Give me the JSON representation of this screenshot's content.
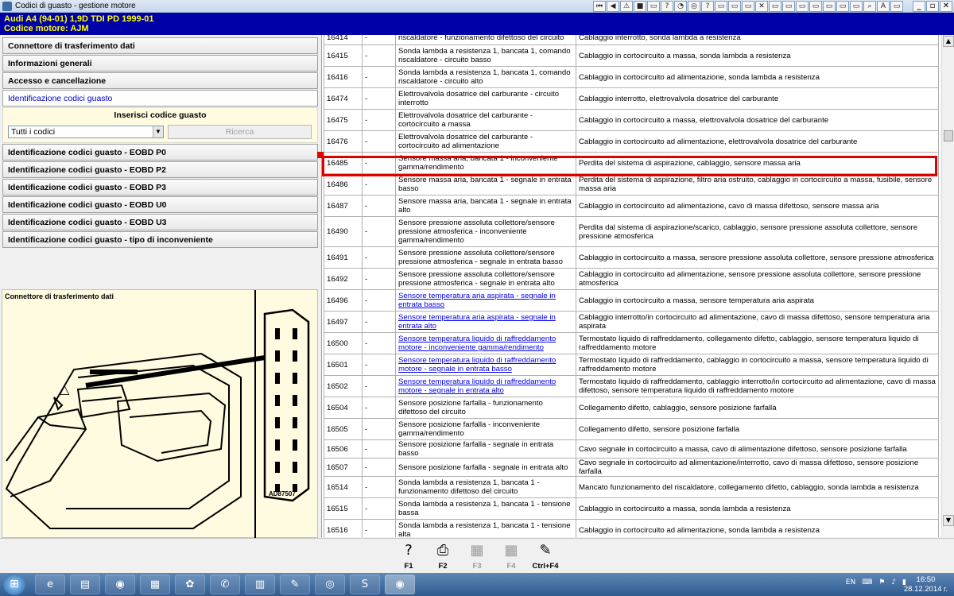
{
  "window": {
    "title": "Codici di guasto - gestione motore"
  },
  "vehicle": {
    "line1": "Audi   A4 (94-01) 1,9D TDI PD 1999-01",
    "line2": "Codice motore: AJM"
  },
  "toolbar_icons": [
    "⏮",
    "◀",
    "⚠",
    "■",
    "▭",
    "?",
    "◔",
    "◎",
    "?",
    "▭",
    "▭",
    "▭",
    "✕",
    "▭",
    "▭",
    "▭",
    "▭",
    "▭",
    "▭",
    "▭",
    "⌕",
    "A",
    "▭"
  ],
  "window_controls": {
    "minimize": "_",
    "restore": "▫",
    "close": "✕"
  },
  "nav": {
    "top_items": [
      "Connettore di trasferimento dati",
      "Informazioni generali",
      "Accesso e cancellazione",
      "Identificazione codici guasto"
    ],
    "search": {
      "label": "Inserisci codice guasto",
      "select_value": "Tutti i codici",
      "button": "Ricerca"
    },
    "bottom_items": [
      "Identificazione codici guasto - EOBD P0",
      "Identificazione codici guasto - EOBD P2",
      "Identificazione codici guasto - EOBD P3",
      "Identificazione codici guasto - EOBD U0",
      "Identificazione codici guasto - EOBD U3",
      "Identificazione codici guasto - tipo di inconveniente"
    ]
  },
  "connector": {
    "caption": "Connettore di trasferimento dati",
    "image_ref": "AD87507"
  },
  "table": {
    "rows": [
      {
        "code": "16414",
        "c2": "-",
        "component": "riscaldatore - funzionamento difettoso del circuito",
        "cause": "Cablaggio interrotto, sonda lambda a resistenza",
        "link": false,
        "h": 18
      },
      {
        "code": "16415",
        "c2": "-",
        "component": "Sonda lambda a resistenza 1, bancata 1, comando riscaldatore - circuito basso",
        "cause": "Cablaggio in cortocircuito a massa, sonda lambda a resistenza",
        "link": false,
        "h": 27
      },
      {
        "code": "16416",
        "c2": "-",
        "component": "Sonda lambda a resistenza 1, bancata 1, comando riscaldatore - circuito alto",
        "cause": "Cablaggio in cortocircuito ad alimentazione, sonda lambda a resistenza",
        "link": false,
        "h": 27
      },
      {
        "code": "16474",
        "c2": "-",
        "component": "Elettrovalvola dosatrice del carburante - circuito interrotto",
        "cause": "Cablaggio interrotto, elettrovalvola dosatrice del carburante",
        "link": false,
        "h": 27
      },
      {
        "code": "16475",
        "c2": "-",
        "component": "Elettrovalvola dosatrice del carburante - cortocircuito a massa",
        "cause": "Cablaggio in cortocircuito a massa, elettrovalvola dosatrice del carburante",
        "link": false,
        "h": 27
      },
      {
        "code": "16476",
        "c2": "-",
        "component": "Elettrovalvola dosatrice del carburante - cortocircuito ad alimentazione",
        "cause": "Cablaggio in cortocircuito ad alimentazione, elettrovalvola dosatrice del carburante",
        "link": false,
        "h": 27
      },
      {
        "code": "16485",
        "c2": "-",
        "component": "Sensore massa aria, bancata 1 - inconveniente gamma/rendimento",
        "cause": "Perdita del sistema di aspirazione, cablaggio, sensore massa aria",
        "link": false,
        "h": 27
      },
      {
        "code": "16486",
        "c2": "-",
        "component": "Sensore massa aria, bancata 1 - segnale in entrata basso",
        "cause": "Perdita del sistema di aspirazione, filtro aria ostruito, cablaggio in cortocircuito a massa, fusibile, sensore massa aria",
        "link": false,
        "h": 27
      },
      {
        "code": "16487",
        "c2": "-",
        "component": "Sensore massa aria, bancata 1 - segnale in entrata alto",
        "cause": "Cablaggio in cortocircuito ad alimentazione, cavo di massa difettoso, sensore massa aria",
        "link": false,
        "h": 27
      },
      {
        "code": "16490",
        "c2": "-",
        "component": "Sensore pressione assoluta collettore/sensore pressione atmosferica - inconveniente gamma/rendimento",
        "cause": "Perdita dal sistema di aspirazione/scarico, cablaggio, sensore pressione assoluta collettore, sensore pressione atmosferica",
        "link": false,
        "h": 38
      },
      {
        "code": "16491",
        "c2": "-",
        "component": "Sensore pressione assoluta collettore/sensore pressione atmosferica - segnale in entrata basso",
        "cause": "Cablaggio in cortocircuito a massa, sensore pressione assoluta collettore, sensore pressione atmosferica",
        "link": false,
        "h": 27
      },
      {
        "code": "16492",
        "c2": "-",
        "component": "Sensore pressione assoluta collettore/sensore pressione atmosferica - segnale in entrata alto",
        "cause": "Cablaggio in cortocircuito ad alimentazione, sensore pressione assoluta collettore, sensore pressione atmosferica",
        "link": false,
        "h": 27
      },
      {
        "code": "16496",
        "c2": "-",
        "component": "Sensore temperatura aria aspirata - segnale in entrata basso",
        "cause": "Cablaggio in cortocircuito a massa, sensore temperatura aria aspirata",
        "link": true,
        "h": 27
      },
      {
        "code": "16497",
        "c2": "-",
        "component": "Sensore temperatura aria aspirata - segnale in entrata alto",
        "cause": "Cablaggio interrotto/in cortocircuito ad alimentazione, cavo di massa difettoso, sensore temperatura aria aspirata",
        "link": true,
        "h": 27
      },
      {
        "code": "16500",
        "c2": "-",
        "component": "Sensore temperatura liquido di raffreddamento motore - inconveniente gamma/rendimento",
        "cause": "Termostato liquido di raffreddamento, collegamento difetto, cablaggio, sensore temperatura liquido di raffreddamento motore",
        "link": true,
        "h": 27
      },
      {
        "code": "16501",
        "c2": "-",
        "component": "Sensore temperatura liquido di raffreddamento motore - segnale in entrata basso",
        "cause": "Termostato liquido di raffreddamento, cablaggio in cortocircuito a massa, sensore temperatura liquido di raffreddamento motore",
        "link": true,
        "h": 27
      },
      {
        "code": "16502",
        "c2": "-",
        "component": "Sensore temperatura liquido di raffreddamento motore - segnale in entrata alto",
        "cause": "Termostato liquido di raffreddamento, cablaggio interrotto/in cortocircuito ad alimentazione, cavo di massa difettoso, sensore temperatura liquido di raffreddamento motore",
        "link": true,
        "h": 27
      },
      {
        "code": "16504",
        "c2": "-",
        "component": "Sensore posizione farfalla - funzionamento difettoso del circuito",
        "cause": "Collegamento difetto, cablaggio, sensore posizione farfalla",
        "link": false,
        "h": 27
      },
      {
        "code": "16505",
        "c2": "-",
        "component": "Sensore posizione farfalla - inconveniente gamma/rendimento",
        "cause": "Collegamento difetto, sensore posizione farfalla",
        "link": false,
        "h": 27
      },
      {
        "code": "16506",
        "c2": "-",
        "component": "Sensore posizione farfalla - segnale in entrata basso",
        "cause": "Cavo segnale in cortocircuito a massa, cavo di alimentazione difettoso, sensore posizione farfalla",
        "link": false,
        "h": 14
      },
      {
        "code": "16507",
        "c2": "-",
        "component": "Sensore posizione farfalla - segnale in entrata alto",
        "cause": "Cavo segnale in cortocircuito ad alimentazione/interrotto, cavo di massa difettoso, sensore posizione farfalla",
        "link": false,
        "h": 14
      },
      {
        "code": "16514",
        "c2": "-",
        "component": "Sonda lambda a resistenza 1, bancata 1 - funzionamento difettoso del circuito",
        "cause": "Mancato funzionamento del riscaldatore, collegamento difetto, cablaggio, sonda lambda a resistenza",
        "link": false,
        "h": 27
      },
      {
        "code": "16515",
        "c2": "-",
        "component": "Sonda lambda a resistenza 1, bancata 1 - tensione bassa",
        "cause": "Cablaggio in cortocircuito a massa, sonda lambda a resistenza",
        "link": false,
        "h": 27
      },
      {
        "code": "16516",
        "c2": "-",
        "component": "Sonda lambda a resistenza 1, bancata 1 - tensione alta",
        "cause": "Cablaggio in cortocircuito ad alimentazione, sonda lambda a resistenza",
        "link": false,
        "h": 27
      }
    ]
  },
  "fkeys": [
    {
      "label": "F1",
      "icon": "?",
      "disabled": false
    },
    {
      "label": "F2",
      "icon": "⎙",
      "disabled": false
    },
    {
      "label": "F3",
      "icon": "▦",
      "disabled": true
    },
    {
      "label": "F4",
      "icon": "▦",
      "disabled": true
    },
    {
      "label": "Ctrl+F4",
      "icon": "✎",
      "disabled": false
    }
  ],
  "taskbar": {
    "apps": [
      "e",
      "▤",
      "◉",
      "▦",
      "✿",
      "✆",
      "▥",
      "✎",
      "◎",
      "S",
      "◉"
    ],
    "tray": {
      "lang": "EN"
    },
    "time": "16:50",
    "date": "28.12.2014 г."
  }
}
